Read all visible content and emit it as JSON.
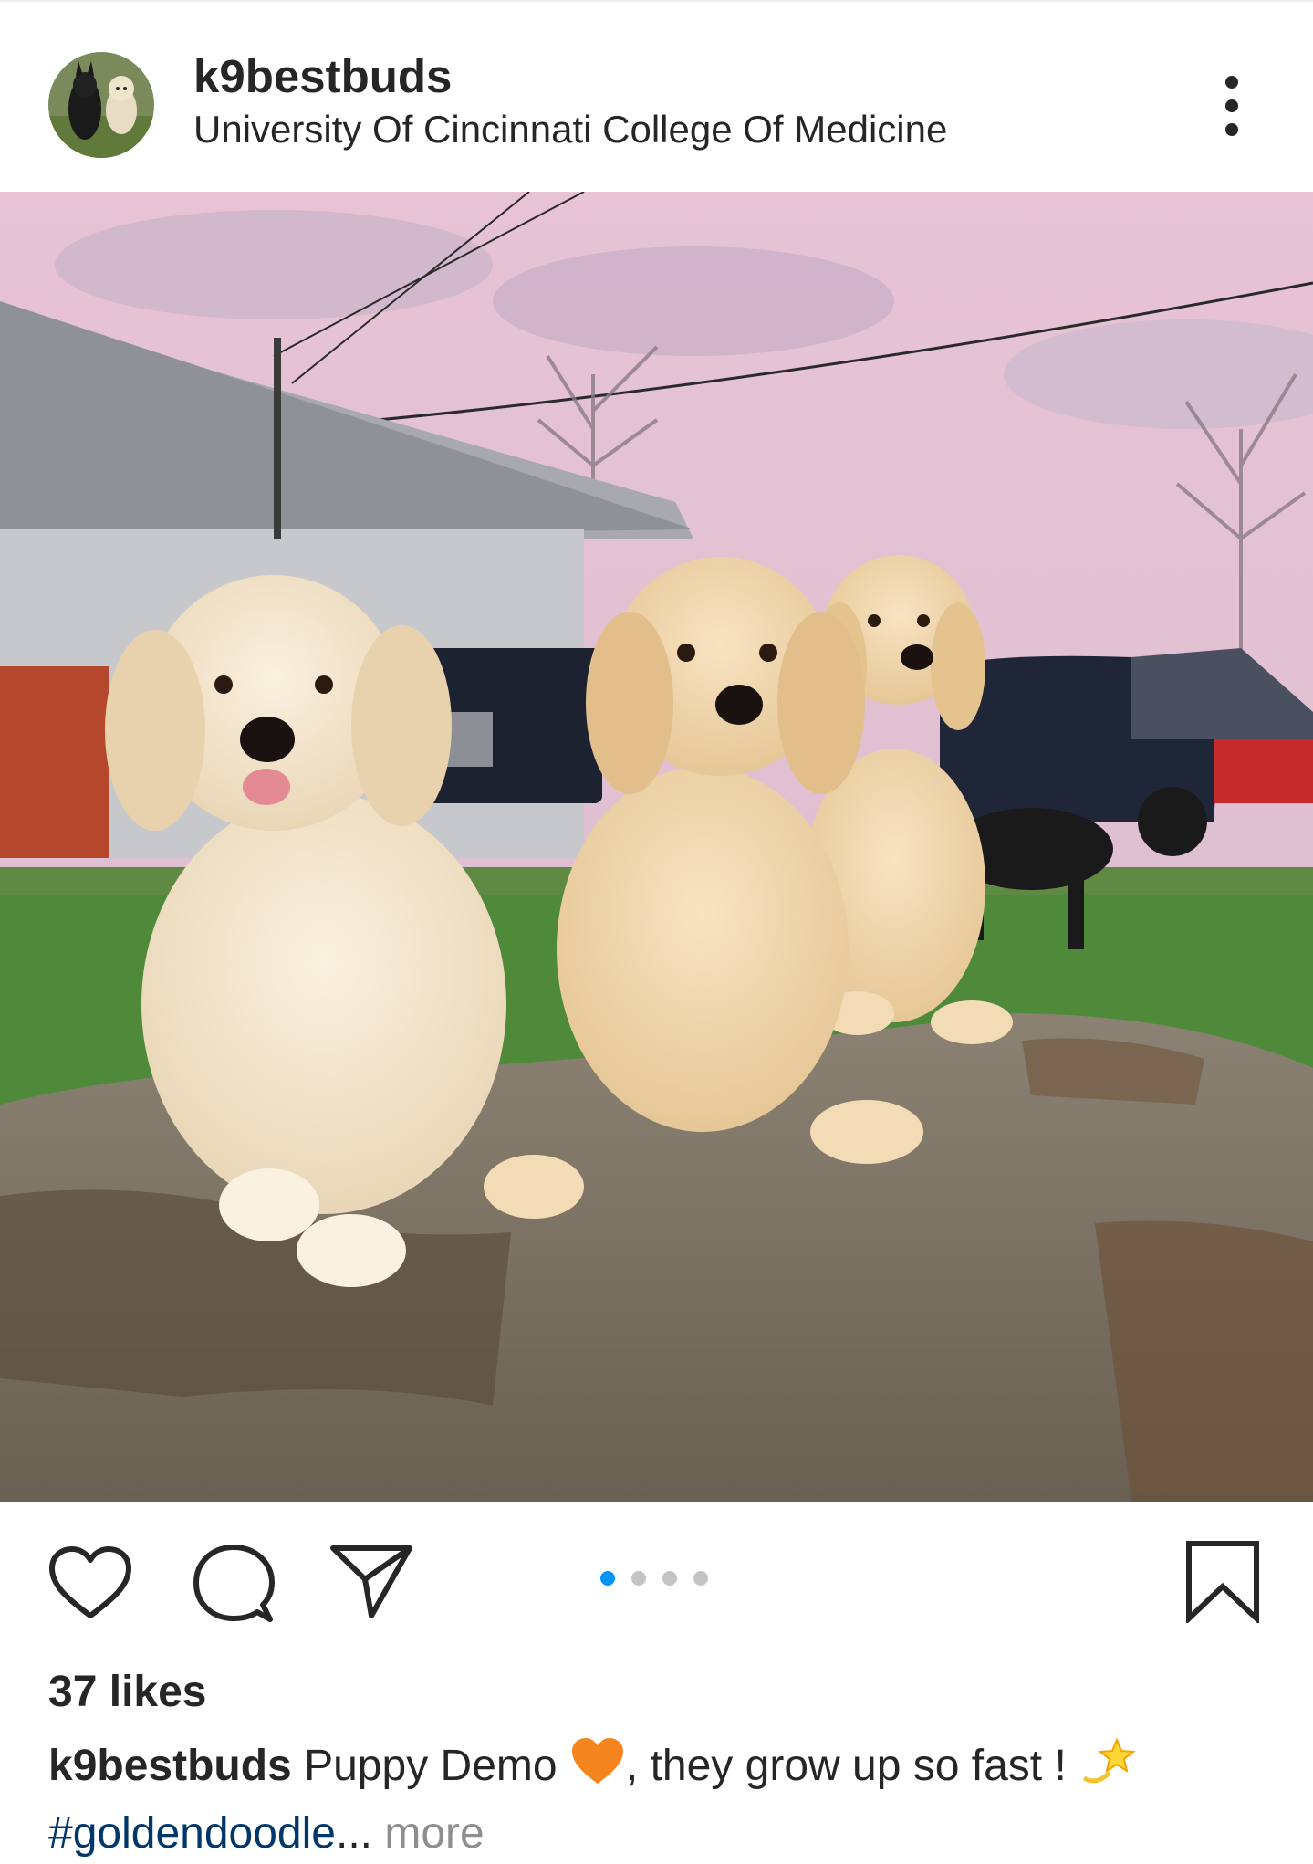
{
  "post": {
    "username": "k9bestbuds",
    "location": "University Of Cincinnati College Of Medicine",
    "likes": "37 likes",
    "caption": {
      "username": "k9bestbuds",
      "text_before_emoji": "Puppy Demo ",
      "text_after_emoji": ", they grow up so fast ! ",
      "hashtag": "#goldendoodle",
      "ellipsis": "...",
      "more": " more"
    }
  },
  "carousel": {
    "total": 4,
    "active_index": 0,
    "active_color": "#0095f6",
    "inactive_color": "#c4c4c4"
  },
  "icons": {
    "more": "three-dots-vertical-icon",
    "like": "heart-outline-icon",
    "comment": "speech-bubble-icon",
    "share": "paper-plane-icon",
    "save": "bookmark-outline-icon",
    "caption_emojis": [
      "orange-heart-emoji",
      "dizzy-star-emoji"
    ]
  },
  "colors": {
    "text": "#262626",
    "hashtag": "#00376b",
    "muted": "#8e8e8e"
  }
}
